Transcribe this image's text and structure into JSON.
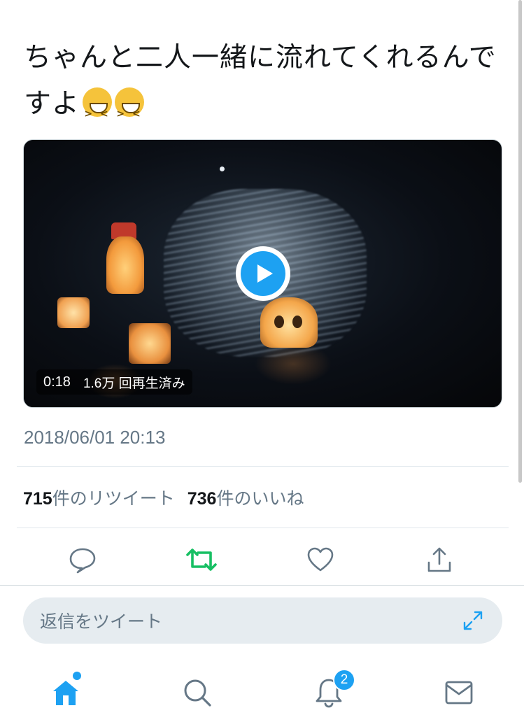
{
  "tweet": {
    "text": "ちゃんと二人一緒に流れてくれるんですよ",
    "emojis": [
      "grinning-squinting-face",
      "grinning-squinting-face"
    ]
  },
  "video": {
    "duration": "0:18",
    "views": "1.6万 回再生済み",
    "play_icon": "play-icon"
  },
  "timestamp": "2018/06/01 20:13",
  "stats": {
    "retweets_count": "715",
    "retweets_label": "件のリツイート",
    "likes_count": "736",
    "likes_label": "件のいいね"
  },
  "actions": [
    {
      "name": "reply",
      "icon": "comment-icon"
    },
    {
      "name": "retweet",
      "icon": "retweet-icon",
      "color": "#17bf63"
    },
    {
      "name": "like",
      "icon": "heart-icon"
    },
    {
      "name": "share",
      "icon": "share-icon"
    }
  ],
  "reply": {
    "placeholder": "返信をツイート",
    "expand_icon": "expand-icon"
  },
  "tabs": [
    {
      "name": "home",
      "icon": "home-icon",
      "active": true
    },
    {
      "name": "search",
      "icon": "search-icon"
    },
    {
      "name": "notifications",
      "icon": "bell-icon",
      "badge": "2"
    },
    {
      "name": "messages",
      "icon": "mail-icon"
    }
  ],
  "colors": {
    "accent": "#1da1f2",
    "retweet": "#17bf63",
    "text": "#14171a",
    "muted": "#657786"
  }
}
